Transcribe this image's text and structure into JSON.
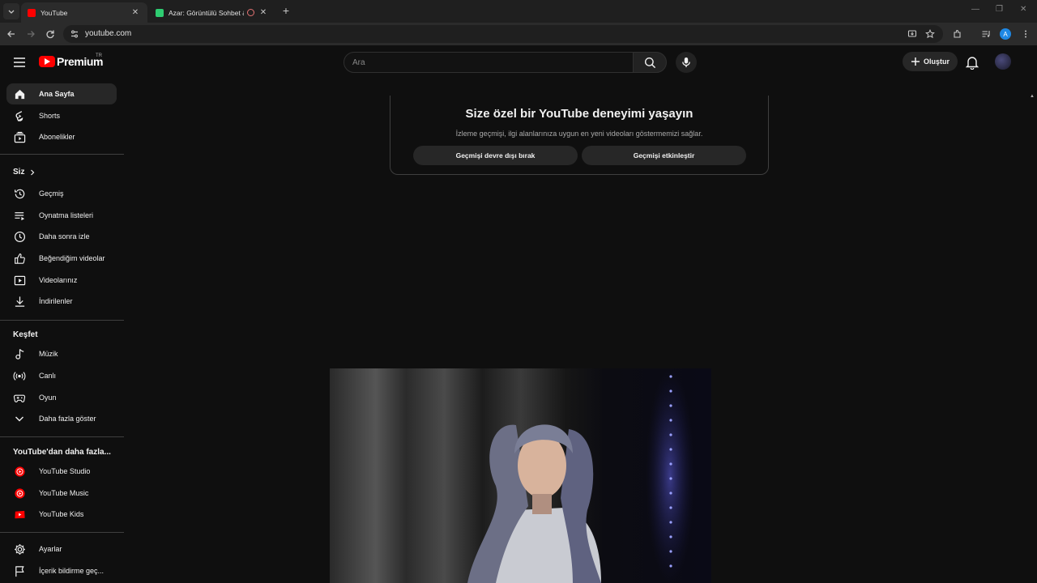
{
  "browser": {
    "tabs": [
      {
        "title": "YouTube",
        "active": true
      },
      {
        "title": "Azar: Görüntülü Sohbet & Y",
        "active": false
      }
    ],
    "url": "youtube.com",
    "profile_initial": "A"
  },
  "masthead": {
    "logo_text": "Premium",
    "logo_country": "TR",
    "search_placeholder": "Ara",
    "create_label": "Oluştur"
  },
  "sidebar": {
    "main": [
      {
        "label": "Ana Sayfa",
        "icon": "home-icon"
      },
      {
        "label": "Shorts",
        "icon": "shorts-icon"
      },
      {
        "label": "Abonelikler",
        "icon": "subscriptions-icon"
      }
    ],
    "you_header": "Siz",
    "you": [
      {
        "label": "Geçmiş",
        "icon": "history-icon"
      },
      {
        "label": "Oynatma listeleri",
        "icon": "playlists-icon"
      },
      {
        "label": "Daha sonra izle",
        "icon": "clock-icon"
      },
      {
        "label": "Beğendiğim videolar",
        "icon": "thumbs-up-icon"
      },
      {
        "label": "Videolarınız",
        "icon": "your-videos-icon"
      },
      {
        "label": "İndirilenler",
        "icon": "download-icon"
      }
    ],
    "explore_header": "Keşfet",
    "explore": [
      {
        "label": "Müzik",
        "icon": "music-icon"
      },
      {
        "label": "Canlı",
        "icon": "live-icon"
      },
      {
        "label": "Oyun",
        "icon": "gaming-icon"
      },
      {
        "label": "Daha fazla göster",
        "icon": "chevron-down-icon"
      }
    ],
    "more_header": "YouTube'dan daha fazla...",
    "more": [
      {
        "label": "YouTube Studio",
        "icon": "youtube-studio-icon"
      },
      {
        "label": "YouTube Music",
        "icon": "youtube-music-icon"
      },
      {
        "label": "YouTube Kids",
        "icon": "youtube-kids-icon"
      }
    ],
    "bottom": [
      {
        "label": "Ayarlar",
        "icon": "settings-icon"
      },
      {
        "label": "İçerik bildirme geç...",
        "icon": "flag-icon"
      }
    ]
  },
  "notice": {
    "title": "Size özel bir YouTube deneyimi yaşayın",
    "subtitle": "İzleme geçmişi, ilgi alanlarınıza uygun en yeni videoları göstermemizi sağlar.",
    "btn_disable": "Geçmişi devre dışı bırak",
    "btn_enable": "Geçmişi etkinleştir"
  },
  "colors": {
    "background": "#0f0f0f",
    "brand_red": "#ff0000",
    "surface": "#272727"
  }
}
